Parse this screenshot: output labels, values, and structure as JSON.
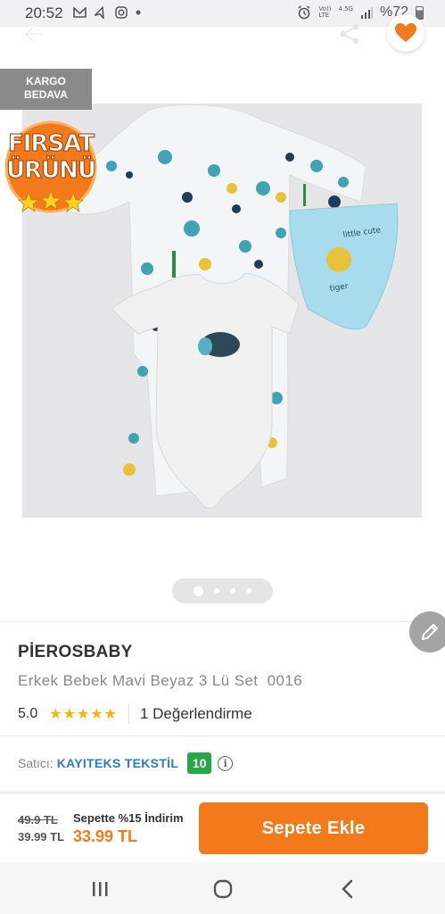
{
  "status_bar": {
    "time": "20:52",
    "network_top": "Vo))",
    "network_mid": "LTE",
    "network_speed": "4.5G",
    "battery_percent": "%72",
    "icons": [
      "mail-icon",
      "navigation-icon",
      "instagram-icon",
      "dot-icon",
      "alarm-icon",
      "signal-icon",
      "battery-icon"
    ]
  },
  "toolbar": {
    "icons": [
      "back-arrow-icon",
      "share-icon",
      "heart-icon"
    ]
  },
  "gallery": {
    "kargo_badge_line1": "KARGO",
    "kargo_badge_line2": "BEDAVA",
    "firsat_line1": "FIRSAT",
    "firsat_line2": "ÜRÜNÜ",
    "page_count": 4,
    "active_page": 1
  },
  "product": {
    "brand": "PİEROSBABY",
    "title": "Erkek Bebek Mavi Beyaz 3 Lü Set  0016",
    "rating": "5.0",
    "stars": "★★★★★",
    "review_count": "1 Değerlendirme"
  },
  "seller": {
    "label": "Satıcı:",
    "name": "KAYITEKS TEKSTİL",
    "score": "10",
    "info_glyph": "i"
  },
  "purchase": {
    "old_price": "49.9 TL",
    "price": "39.99 TL",
    "basket_discount": "Sepette %15 İndirim",
    "final_price": "33.99 TL",
    "add_to_cart": "Sepete Ekle"
  },
  "colors": {
    "accent": "#f27a1a",
    "seller_link": "#2d7bc4",
    "seller_score_bg": "#27a844",
    "star": "#f7b500"
  }
}
